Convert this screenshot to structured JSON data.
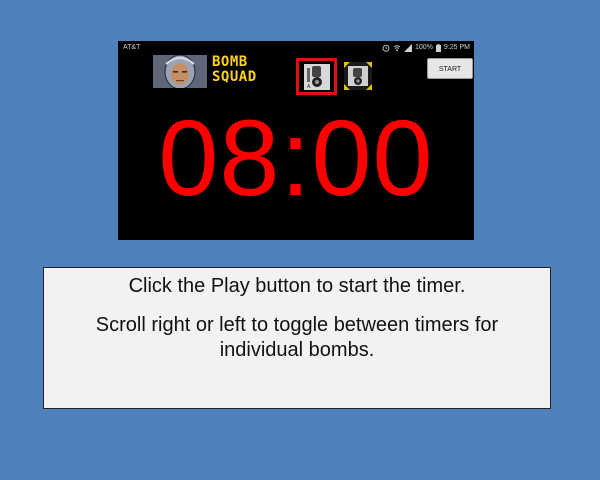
{
  "status_bar": {
    "carrier": "AT&T",
    "battery": "100%",
    "time": "9:25 PM",
    "icons": [
      "alarm-icon",
      "wifi-icon",
      "signal-icon",
      "battery-icon"
    ]
  },
  "app": {
    "logo_line1": "BOMB",
    "logo_line2": "SQUAD",
    "start_label": "START",
    "timer": "08:00",
    "timer_color": "#ff0000",
    "logo_color": "#ffd21a",
    "selected_border_color": "#e11010",
    "bomb_icons": [
      {
        "name": "bomb-a-icon",
        "selected": true
      },
      {
        "name": "bomb-b-icon",
        "selected": false
      }
    ]
  },
  "instructions": {
    "line1": "Click the Play button to start the timer.",
    "line2": "Scroll right or left to toggle between timers for individual bombs."
  },
  "colors": {
    "background": "#4f81bd",
    "box": "#f2f2f2"
  }
}
